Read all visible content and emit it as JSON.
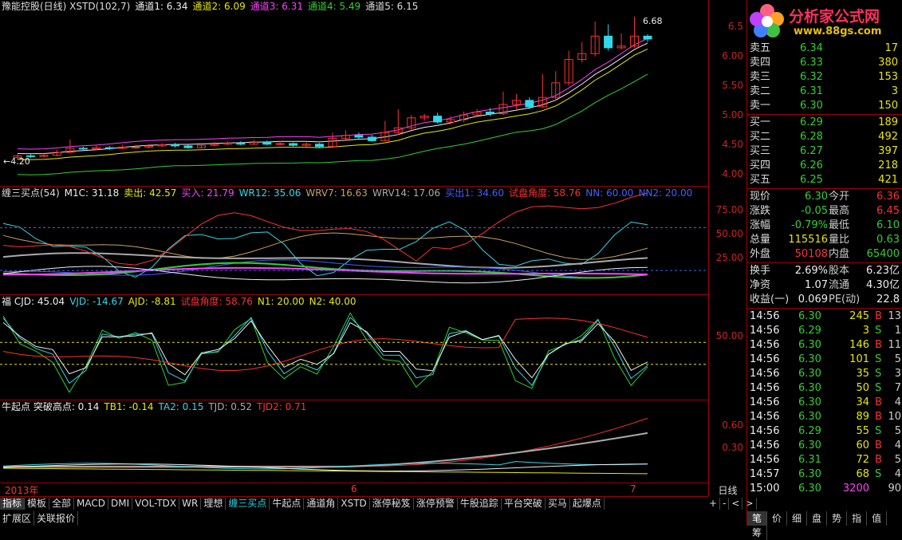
{
  "kline": {
    "header": [
      {
        "text": "豫能控股(日线) XSTD(102,7)",
        "color": "#dddddd"
      },
      {
        "text": "通道1: 6.34",
        "color": "#eeeeee"
      },
      {
        "text": "通道2: 6.09",
        "color": "#e8e800"
      },
      {
        "text": "通道3: 6.31",
        "color": "#ff40ff"
      },
      {
        "text": "通道4: 5.49",
        "color": "#30d030"
      },
      {
        "text": "通道5: 6.15",
        "color": "#dddddd"
      }
    ],
    "ticks": [
      "6.5",
      "6.00",
      "5.50",
      "5.00",
      "4.50",
      "4.00"
    ],
    "high_label": "6.68",
    "low_label": "4.20",
    "candles": [
      [
        4.27,
        4.3,
        4.33,
        4.24
      ],
      [
        4.3,
        4.29,
        4.33,
        4.26
      ],
      [
        4.29,
        4.31,
        4.34,
        4.27
      ],
      [
        4.31,
        4.36,
        4.4,
        4.29
      ],
      [
        4.36,
        4.43,
        4.58,
        4.34
      ],
      [
        4.43,
        4.42,
        4.46,
        4.38
      ],
      [
        4.42,
        4.44,
        4.48,
        4.4
      ],
      [
        4.44,
        4.43,
        4.47,
        4.4
      ],
      [
        4.43,
        4.45,
        4.49,
        4.41
      ],
      [
        4.45,
        4.45,
        4.49,
        4.42
      ],
      [
        4.45,
        4.47,
        4.5,
        4.43
      ],
      [
        4.47,
        4.49,
        4.52,
        4.45
      ],
      [
        4.49,
        4.47,
        4.52,
        4.44
      ],
      [
        4.47,
        4.44,
        4.49,
        4.42
      ],
      [
        4.44,
        4.48,
        4.52,
        4.43
      ],
      [
        4.48,
        4.5,
        4.54,
        4.46
      ],
      [
        4.5,
        4.52,
        4.55,
        4.48
      ],
      [
        4.52,
        4.5,
        4.55,
        4.48
      ],
      [
        4.5,
        4.54,
        4.58,
        4.49
      ],
      [
        4.54,
        4.5,
        4.56,
        4.48
      ],
      [
        4.5,
        4.51,
        4.55,
        4.48
      ],
      [
        4.51,
        4.48,
        4.53,
        4.46
      ],
      [
        4.48,
        4.5,
        4.53,
        4.46
      ],
      [
        4.5,
        4.46,
        4.52,
        4.44
      ],
      [
        4.46,
        4.6,
        4.7,
        4.46
      ],
      [
        4.6,
        4.65,
        4.74,
        4.58
      ],
      [
        4.65,
        4.62,
        4.7,
        4.58
      ],
      [
        4.62,
        4.56,
        4.66,
        4.54
      ],
      [
        4.56,
        4.7,
        4.9,
        4.55
      ],
      [
        4.7,
        4.78,
        5.1,
        4.66
      ],
      [
        4.78,
        4.95,
        5.0,
        4.74
      ],
      [
        4.95,
        4.98,
        5.02,
        4.9
      ],
      [
        4.98,
        4.88,
        5.04,
        4.85
      ],
      [
        4.88,
        4.92,
        4.98,
        4.84
      ],
      [
        4.92,
        5.0,
        5.06,
        4.88
      ],
      [
        5.0,
        5.05,
        5.1,
        4.96
      ],
      [
        5.05,
        5.02,
        5.12,
        4.98
      ],
      [
        5.02,
        5.18,
        5.4,
        5.0
      ],
      [
        5.18,
        5.25,
        5.36,
        5.1
      ],
      [
        5.25,
        5.14,
        5.3,
        5.1
      ],
      [
        5.14,
        5.3,
        5.7,
        5.12
      ],
      [
        5.3,
        5.55,
        5.75,
        5.25
      ],
      [
        5.55,
        5.95,
        6.1,
        5.5
      ],
      [
        5.95,
        6.05,
        6.25,
        5.9
      ],
      [
        6.05,
        6.35,
        6.6,
        6.0
      ],
      [
        6.35,
        6.15,
        6.55,
        6.1
      ],
      [
        6.15,
        6.18,
        6.4,
        6.12
      ],
      [
        6.18,
        6.35,
        6.68,
        6.15
      ],
      [
        6.35,
        6.3,
        6.38,
        6.25
      ]
    ],
    "channels": {
      "c1_color": "#ff40ff",
      "c2_color": "#eeeeee",
      "c3_color": "#e8e800",
      "c4_color": "#30d030"
    }
  },
  "ind1": {
    "header": [
      {
        "text": "缠三买点(54)",
        "color": "#dddddd"
      },
      {
        "text": "M1C: 31.18",
        "color": "#eeeeee"
      },
      {
        "text": "卖出: 42.57",
        "color": "#e8e800"
      },
      {
        "text": "买入: 21.79",
        "color": "#ff40ff"
      },
      {
        "text": "WR12: 35.06",
        "color": "#30d8e8"
      },
      {
        "text": "WRV7: 16.63",
        "color": "#c8a060"
      },
      {
        "text": "WRV14: 17.06",
        "color": "#aaaaaa"
      },
      {
        "text": "买出1: 34.60",
        "color": "#4060ff"
      },
      {
        "text": "试盘角度: 58.76",
        "color": "#ff3030"
      },
      {
        "text": "NN: 60.00",
        "color": "#4060ff"
      },
      {
        "text": "NN2: 20.00",
        "color": "#4060ff"
      }
    ],
    "ticks": [
      "75.00",
      "50.00",
      "25.00"
    ]
  },
  "ind2": {
    "header": [
      {
        "text": "福 CJD: 45.04",
        "color": "#eeeeee"
      },
      {
        "text": "VJD: -14.67",
        "color": "#30d8e8"
      },
      {
        "text": "AJD: -8.81",
        "color": "#e8e800"
      },
      {
        "text": "试盘角度: 58.76",
        "color": "#ff3030"
      },
      {
        "text": "N1: 20.00",
        "color": "#e8e800"
      },
      {
        "text": "N2: 40.00",
        "color": "#e8e800"
      }
    ],
    "ticks": [
      "50.00"
    ]
  },
  "ind3": {
    "header": [
      {
        "text": "牛起点 突破高点: 0.14",
        "color": "#eeeeee"
      },
      {
        "text": "TB1: -0.14",
        "color": "#e8e800"
      },
      {
        "text": "TA2: 0.15",
        "color": "#30d8e8"
      },
      {
        "text": "TJD: 0.52",
        "color": "#aaaaaa"
      },
      {
        "text": "TJD2: 0.71",
        "color": "#ff3030"
      }
    ],
    "ticks": [
      "0.60",
      "0.30"
    ]
  },
  "timeline": {
    "labels": [
      "2013年",
      "6",
      "7"
    ],
    "period": "日线"
  },
  "tabs": [
    "指标",
    "模板",
    "全部",
    "MACD",
    "DMI",
    "VOL-TDX",
    "WR",
    "理想",
    "缠三买点",
    "牛起点",
    "通道角",
    "XSTD",
    "涨停秘笈",
    "涨停预警",
    "牛股追踪",
    "平台突破",
    "买马",
    "起爆点"
  ],
  "tabs2": [
    "扩展区",
    "关联报价"
  ],
  "tab_ctrl": [
    "+",
    "-",
    "<",
    ">"
  ],
  "logo": {
    "title": "分析家公式网",
    "url": "www.88gs.com"
  },
  "orderbook": {
    "sell": [
      {
        "label": "卖五",
        "price": "6.34",
        "vol": "17"
      },
      {
        "label": "卖四",
        "price": "6.33",
        "vol": "380"
      },
      {
        "label": "卖三",
        "price": "6.32",
        "vol": "153"
      },
      {
        "label": "卖二",
        "price": "6.31",
        "vol": "3"
      },
      {
        "label": "卖一",
        "price": "6.30",
        "vol": "150"
      }
    ],
    "buy": [
      {
        "label": "买一",
        "price": "6.29",
        "vol": "189"
      },
      {
        "label": "买二",
        "price": "6.28",
        "vol": "492"
      },
      {
        "label": "买三",
        "price": "6.27",
        "vol": "397"
      },
      {
        "label": "买四",
        "price": "6.26",
        "vol": "218"
      },
      {
        "label": "买五",
        "price": "6.25",
        "vol": "421"
      }
    ]
  },
  "quote": [
    {
      "l1": "现价",
      "v1": "6.30",
      "c1": "#30d030",
      "l2": "今开",
      "v2": "6.36",
      "c2": "#ff3030"
    },
    {
      "l1": "涨跌",
      "v1": "-0.05",
      "c1": "#30d030",
      "l2": "最高",
      "v2": "6.45",
      "c2": "#ff3030"
    },
    {
      "l1": "涨幅",
      "v1": "-0.79%",
      "c1": "#30d030",
      "l2": "最低",
      "v2": "6.10",
      "c2": "#30d030"
    },
    {
      "l1": "总量",
      "v1": "115516",
      "c1": "#e8e800",
      "l2": "量比",
      "v2": "0.63",
      "c2": "#30d030"
    },
    {
      "l1": "外盘",
      "v1": "50108",
      "c1": "#ff3030",
      "l2": "内盘",
      "v2": "65400",
      "c2": "#30d030"
    }
  ],
  "fin": [
    {
      "l1": "换手",
      "v1": "2.69%",
      "l2": "股本",
      "v2": "6.23亿"
    },
    {
      "l1": "净资",
      "v1": "1.07",
      "l2": "流通",
      "v2": "4.30亿"
    },
    {
      "l1": "收益(一)",
      "v1": "0.069",
      "l2": "PE(动)",
      "v2": "22.8"
    }
  ],
  "ticksList": [
    {
      "t": "14:56",
      "p": "6.30",
      "pc": "#30d030",
      "v": "245",
      "vc": "#e8e800",
      "s": "B",
      "sc": "#ff3030",
      "n": "13"
    },
    {
      "t": "14:56",
      "p": "6.29",
      "pc": "#30d030",
      "v": "3",
      "vc": "#e8e800",
      "s": "S",
      "sc": "#30d030",
      "n": "1"
    },
    {
      "t": "14:56",
      "p": "6.30",
      "pc": "#30d030",
      "v": "146",
      "vc": "#e8e800",
      "s": "B",
      "sc": "#ff3030",
      "n": "11"
    },
    {
      "t": "14:56",
      "p": "6.30",
      "pc": "#30d030",
      "v": "101",
      "vc": "#e8e800",
      "s": "S",
      "sc": "#30d030",
      "n": "5"
    },
    {
      "t": "14:56",
      "p": "6.30",
      "pc": "#30d030",
      "v": "35",
      "vc": "#e8e800",
      "s": "S",
      "sc": "#30d030",
      "n": "3"
    },
    {
      "t": "14:56",
      "p": "6.30",
      "pc": "#30d030",
      "v": "50",
      "vc": "#e8e800",
      "s": "S",
      "sc": "#30d030",
      "n": "7"
    },
    {
      "t": "14:56",
      "p": "6.30",
      "pc": "#30d030",
      "v": "34",
      "vc": "#e8e800",
      "s": "B",
      "sc": "#ff3030",
      "n": "4"
    },
    {
      "t": "14:56",
      "p": "6.30",
      "pc": "#30d030",
      "v": "89",
      "vc": "#e8e800",
      "s": "B",
      "sc": "#ff3030",
      "n": "10"
    },
    {
      "t": "14:56",
      "p": "6.29",
      "pc": "#30d030",
      "v": "55",
      "vc": "#e8e800",
      "s": "S",
      "sc": "#30d030",
      "n": "5"
    },
    {
      "t": "14:56",
      "p": "6.30",
      "pc": "#30d030",
      "v": "60",
      "vc": "#e8e800",
      "s": "B",
      "sc": "#ff3030",
      "n": "4"
    },
    {
      "t": "14:56",
      "p": "6.31",
      "pc": "#30d030",
      "v": "72",
      "vc": "#e8e800",
      "s": "B",
      "sc": "#ff3030",
      "n": "5"
    },
    {
      "t": "14:57",
      "p": "6.30",
      "pc": "#30d030",
      "v": "68",
      "vc": "#e8e800",
      "s": "S",
      "sc": "#30d030",
      "n": "4"
    },
    {
      "t": "15:00",
      "p": "6.30",
      "pc": "#30d030",
      "v": "3200",
      "vc": "#ff40ff",
      "s": "",
      "sc": "#30d030",
      "n": "90"
    }
  ],
  "bottom_tabs": [
    "笔",
    "价",
    "细",
    "盘",
    "势",
    "指",
    "值",
    "筹"
  ]
}
